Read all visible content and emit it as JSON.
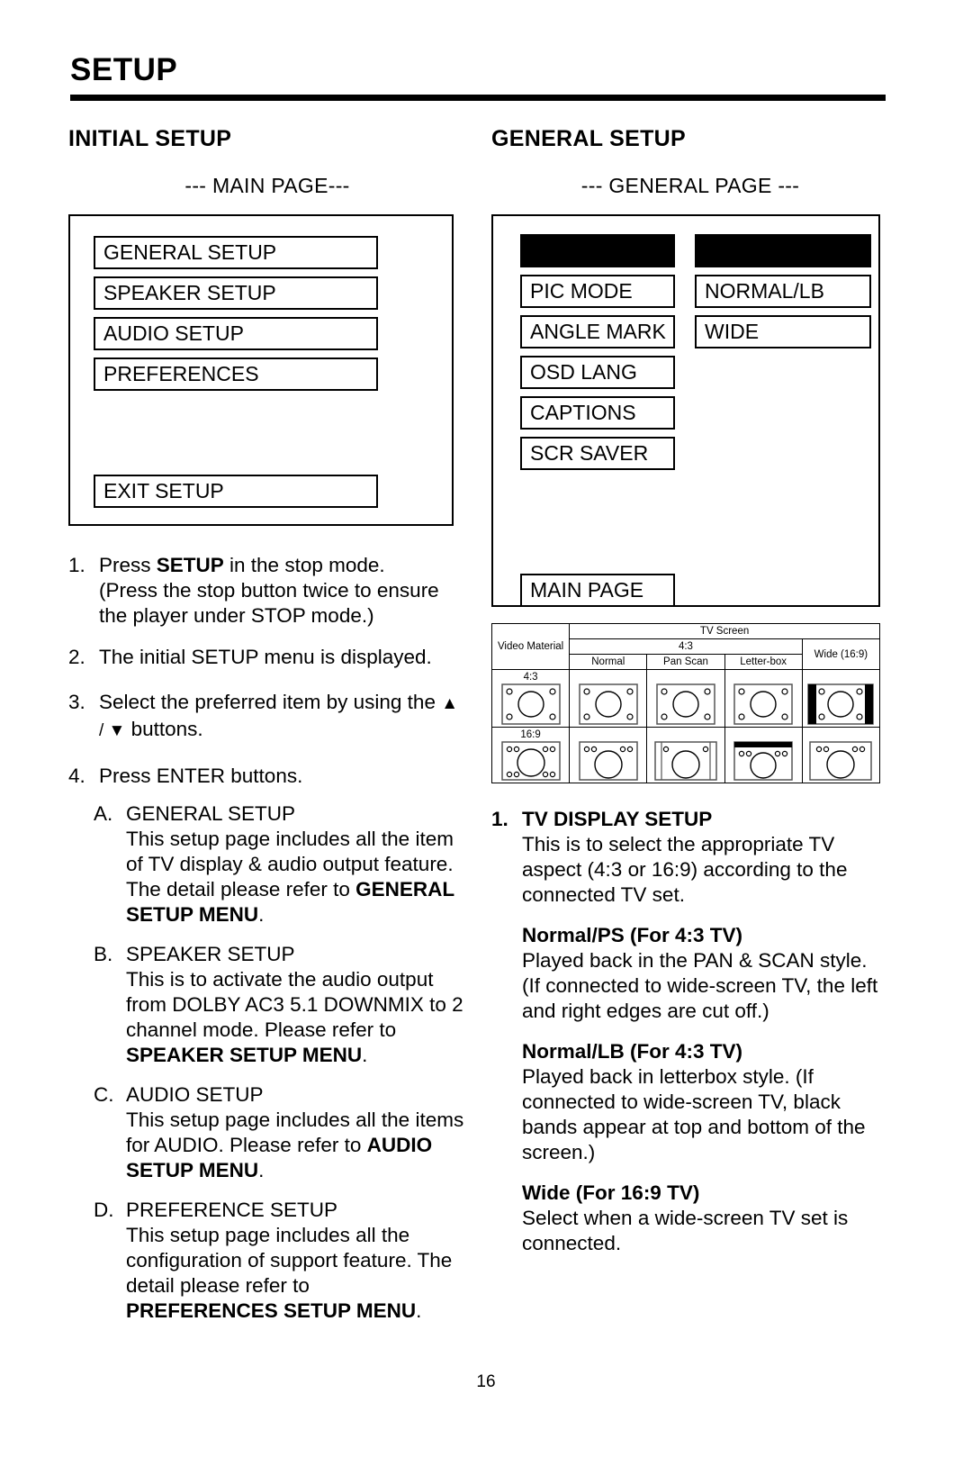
{
  "document": {
    "title": "SETUP",
    "page_number": "16"
  },
  "left_column": {
    "section_title": "INITIAL SETUP",
    "page_label": "--- MAIN PAGE---",
    "osd_menu": {
      "items": [
        "GENERAL SETUP",
        "SPEAKER SETUP",
        "AUDIO SETUP",
        "PREFERENCES"
      ],
      "exit_item": "EXIT SETUP"
    },
    "steps": [
      {
        "marker": "1.",
        "line1_pre": "Press ",
        "line1_bold": "SETUP",
        "line1_post": " in the stop mode.",
        "line2": "(Press the stop button twice to ensure the player under STOP mode.)"
      },
      {
        "marker": "2.",
        "text": "The initial SETUP menu is displayed."
      },
      {
        "marker": "3.",
        "text_pre": "Select the preferred item by using the ",
        "symbols": "▲ / ▼",
        "text_post": " buttons."
      },
      {
        "marker": "4.",
        "text": "Press ENTER buttons."
      }
    ],
    "sub_items": [
      {
        "marker": "A.",
        "heading": "GENERAL SETUP",
        "body_pre": "This setup page includes all the item of TV display & audio output feature.  The detail please refer to ",
        "body_bold": "GENERAL SETUP MENU",
        "body_post": "."
      },
      {
        "marker": "B.",
        "heading": "SPEAKER SETUP",
        "body_pre": "This is to activate the audio output from DOLBY AC3 5.1 DOWNMIX to 2 channel mode.  Please refer to ",
        "body_bold": "SPEAKER SETUP MENU",
        "body_post": "."
      },
      {
        "marker": "C.",
        "heading": "AUDIO SETUP",
        "body_pre": "This setup page includes all the items for AUDIO.  Please refer to ",
        "body_bold": "AUDIO SETUP MENU",
        "body_post": "."
      },
      {
        "marker": "D.",
        "heading": "PREFERENCE SETUP",
        "body_pre": "This setup page includes all the configuration of support feature. The detail please refer to ",
        "body_bold": "PREFERENCES SETUP MENU",
        "body_post": "."
      }
    ]
  },
  "right_column": {
    "section_title": "GENERAL SETUP",
    "page_label": "--- GENERAL PAGE ---",
    "osd_menu": {
      "left_items": [
        "PIC MODE",
        "ANGLE MARK",
        "OSD LANG",
        "CAPTIONS",
        "SCR SAVER"
      ],
      "right_items": [
        "NORMAL/LB",
        "WIDE"
      ],
      "main_page_item": "MAIN PAGE"
    },
    "tv_table": {
      "corner_label": "Video Material",
      "top_header": "TV Screen",
      "group_4_3": "4:3",
      "group_wide": "Wide (16:9)",
      "sub_headers": [
        "Normal",
        "Pan Scan",
        "Letter-box"
      ],
      "rows": [
        {
          "label": "4:3"
        },
        {
          "label": "16:9"
        }
      ]
    },
    "body": {
      "item_number": "1.",
      "item_heading": "TV DISPLAY SETUP",
      "item_text": "This is to select the appropriate TV aspect (4:3 or 16:9) according to the connected TV set.",
      "blocks": [
        {
          "heading": "Normal/PS (For 4:3 TV)",
          "text": "Played back in the PAN & SCAN style. (If connected to wide-screen TV, the left and right edges are cut off.)"
        },
        {
          "heading": "Normal/LB (For 4:3 TV)",
          "text": "Played back in letterbox style. (If connected to wide-screen TV, black bands appear at top and bottom of the screen.)"
        },
        {
          "heading": "Wide (For 16:9 TV)",
          "text": "Select when a wide-screen TV set is connected."
        }
      ]
    }
  }
}
